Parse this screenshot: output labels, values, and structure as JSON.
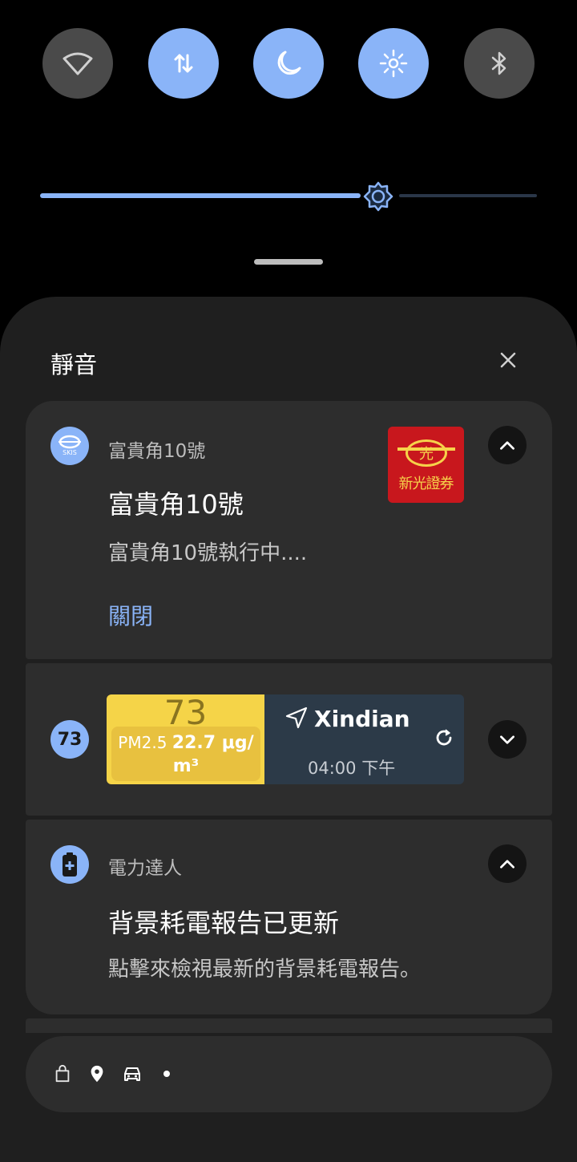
{
  "quick_settings": {
    "tiles": [
      {
        "icon": "wifi-icon",
        "active": false
      },
      {
        "icon": "mobile-data-icon",
        "active": true
      },
      {
        "icon": "dark-mode-icon",
        "active": true
      },
      {
        "icon": "eye-comfort-icon",
        "active": true
      },
      {
        "icon": "bluetooth-icon",
        "active": false
      }
    ],
    "brightness_level": 0.68
  },
  "shade": {
    "section_title": "靜音"
  },
  "notifications": [
    {
      "app_name": "富貴角10號",
      "title": "富貴角10號",
      "text": "富貴角10號執行中....",
      "action": "關閉",
      "large_icon_text": "新光證券",
      "large_icon_char": "光",
      "small_icon_text": "SKIS"
    },
    {
      "badge": "73",
      "aqi": "73",
      "pm_label": "PM2.5",
      "pm_value": "22.7 μg/",
      "pm_unit": "m³",
      "location": "Xindian",
      "time": "04:00 下午"
    },
    {
      "app_name": "電力達人",
      "title": "背景耗電報告已更新",
      "text": "點擊來檢視最新的背景耗電報告。"
    }
  ],
  "status_icons": [
    "shopping-bag-icon",
    "location-pin-icon",
    "car-icon",
    "dot-icon"
  ],
  "colors": {
    "accent": "#8ab4f8",
    "card": "#2d2d2d",
    "shade": "#1f1f1f",
    "aqi_yellow": "#f5d448"
  }
}
